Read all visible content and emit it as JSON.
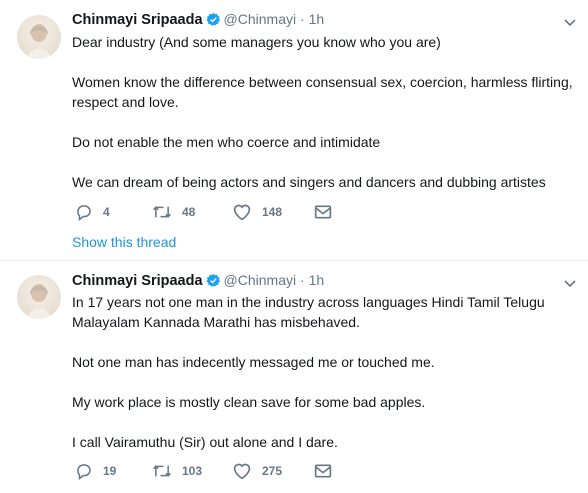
{
  "tweets": [
    {
      "name": "Chinmayi Sripaada",
      "handle": "@Chinmayi",
      "separator": "·",
      "time": "1h",
      "paragraphs": [
        "Dear industry (And some managers you know who you are)",
        "Women know the difference between consensual sex, coercion, harmless flirting, respect and love.",
        "Do not enable the men who coerce and intimidate",
        "We can dream of being actors and singers and dancers and dubbing artistes"
      ],
      "replies": "4",
      "retweets": "48",
      "likes": "148",
      "show_thread": "Show this thread"
    },
    {
      "name": "Chinmayi Sripaada",
      "handle": "@Chinmayi",
      "separator": "·",
      "time": "1h",
      "paragraphs": [
        "In 17 years not one man in the industry across languages Hindi Tamil Telugu Malayalam Kannada Marathi has misbehaved.",
        "Not one man has indecently messaged me or touched me.",
        "My work place is mostly clean save for some bad apples.",
        "I call Vairamuthu (Sir) out alone and I dare."
      ],
      "replies": "19",
      "retweets": "103",
      "likes": "275"
    }
  ],
  "icons": {
    "reply": "reply-icon",
    "retweet": "retweet-icon",
    "like": "heart-icon",
    "dm": "envelope-icon",
    "verified": "verified-badge-icon",
    "caret": "chevron-down-icon"
  },
  "colors": {
    "text": "#14171a",
    "secondary": "#657786",
    "link": "#1b95e0",
    "verified": "#1da1f2",
    "divider": "#e6ecf0"
  }
}
